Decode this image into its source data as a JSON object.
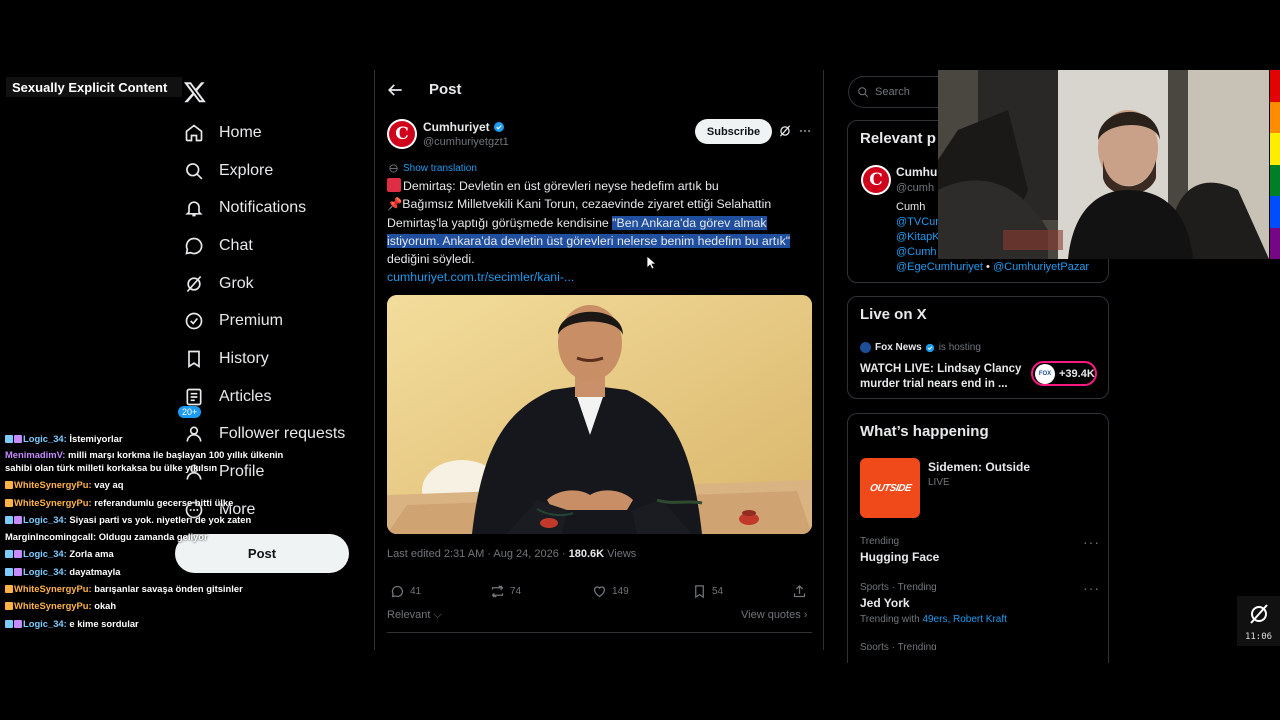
{
  "overlay": {
    "warning_label": "Sexually Explicit Content"
  },
  "nav": {
    "items": [
      {
        "label": "Home",
        "icon": "home-icon"
      },
      {
        "label": "Explore",
        "icon": "search-icon"
      },
      {
        "label": "Notifications",
        "icon": "bell-icon"
      },
      {
        "label": "Chat",
        "icon": "chat-icon"
      },
      {
        "label": "Grok",
        "icon": "grok-icon"
      },
      {
        "label": "Premium",
        "icon": "premium-icon"
      },
      {
        "label": "History",
        "icon": "bookmark-icon"
      },
      {
        "label": "Articles",
        "icon": "articles-icon"
      },
      {
        "label": "Follower requests",
        "icon": "follower-icon",
        "badge": "20+"
      },
      {
        "label": "Profile",
        "icon": "profile-icon"
      },
      {
        "label": "More",
        "icon": "more-icon"
      }
    ],
    "post_button": "Post"
  },
  "chat": {
    "messages": [
      {
        "user": "Logic_34:",
        "text": "İstemiyorlar",
        "color": "#7ecbff"
      },
      {
        "user": "MenimadimV:",
        "text": "milli marşı korkma ile başlayan 100 yıllık ülkenin sahibi olan türk milleti korkaksa bu ülke yıkılsın",
        "color": "#c58bff"
      },
      {
        "user": "WhiteSynergyPu:",
        "text": "vay aq",
        "color": "#ffb347"
      },
      {
        "user": "WhiteSynergyPu:",
        "text": "referandumlu gecerse bitti ülke",
        "color": "#ffb347"
      },
      {
        "user": "Logic_34:",
        "text": "Siyasi parti vs yok. niyetleri de yok zaten",
        "color": "#7ecbff"
      },
      {
        "user": "MarginIncomingcall:",
        "text": "Oldugu zamanda geliyor",
        "color": "#ffffff"
      },
      {
        "user": "Logic_34:",
        "text": "Zorla ama",
        "color": "#7ecbff"
      },
      {
        "user": "Logic_34:",
        "text": "dayatmayla",
        "color": "#7ecbff"
      },
      {
        "user": "WhiteSynergyPu:",
        "text": "barışanlar savaşa önden gitsinler",
        "color": "#ffb347"
      },
      {
        "user": "WhiteSynergyPu:",
        "text": "okah",
        "color": "#ffb347"
      },
      {
        "user": "Logic_34:",
        "text": "e kime sordular",
        "color": "#7ecbff"
      }
    ]
  },
  "post": {
    "header_title": "Post",
    "author_name": "Cumhuriyet",
    "author_handle": "@cumhuriyetgzt1",
    "subscribe_label": "Subscribe",
    "show_translation": "Show translation",
    "line1": "Demirtaş: Devletin en üst görevleri neyse hedefim artık bu",
    "line2_prefix": "📌Bağımsız Milletvekili Kani Torun, cezaevinde ziyaret ettiği Selahattin Demirtaş'la yaptığı görüşmede kendisine ",
    "highlighted": "\"Ben Ankara'da görev almak istiyorum. Ankara'da devletin üst görevleri nelerse benim hedefim bu artık\"",
    "line2_suffix": " dediğini söyledi.",
    "link": "cumhuriyet.com.tr/secimler/kani-...",
    "edited_label": "Last edited 2:31 AM · Aug 24, 2026 · ",
    "views_count": "180.6K",
    "views_label": " Views",
    "replies": "41",
    "reposts": "74",
    "likes": "149",
    "bookmarks": "54",
    "sort_label": "Relevant",
    "view_quotes": "View quotes"
  },
  "right": {
    "search_placeholder": "Search",
    "relevant_title": "Relevant p",
    "rel_name": "Cumhur",
    "rel_handle": "@cumh",
    "rel_bio_line1": "Cumh",
    "rel_bio_mentions": [
      "@TVCur",
      "@KitapK",
      "@Cumh"
    ],
    "rel_bio_last_a": "@EgeCumhuriyet",
    "rel_bio_sep": " • ",
    "rel_bio_last_b": "@CumhuriyetPazar",
    "live_title": "Live on X",
    "live_host": "Fox News",
    "live_status": "is hosting",
    "live_headline": "WATCH LIVE: Lindsay Clancy murder trial nears end in ...",
    "live_count": "+39.4K",
    "whats_happening": "What’s happening",
    "event_title": "Sidemen: Outside",
    "event_status": "LIVE",
    "event_image_text": "OUTSIDE",
    "trends": [
      {
        "context": "Trending",
        "name": "Hugging Face",
        "extra": ""
      },
      {
        "context": "Sports · Trending",
        "name": "Jed York",
        "extra_prefix": "Trending with ",
        "extra": "49ers, Robert Kraft"
      },
      {
        "context": "Sports · Trending",
        "name": "",
        "extra": ""
      }
    ]
  },
  "clock": {
    "time": "11:06"
  },
  "colors": {
    "accent": "#1d9bf0",
    "highlight": "#1f4f9e",
    "cumhuriyet_red": "#d0021b",
    "pink": "#f91880"
  }
}
